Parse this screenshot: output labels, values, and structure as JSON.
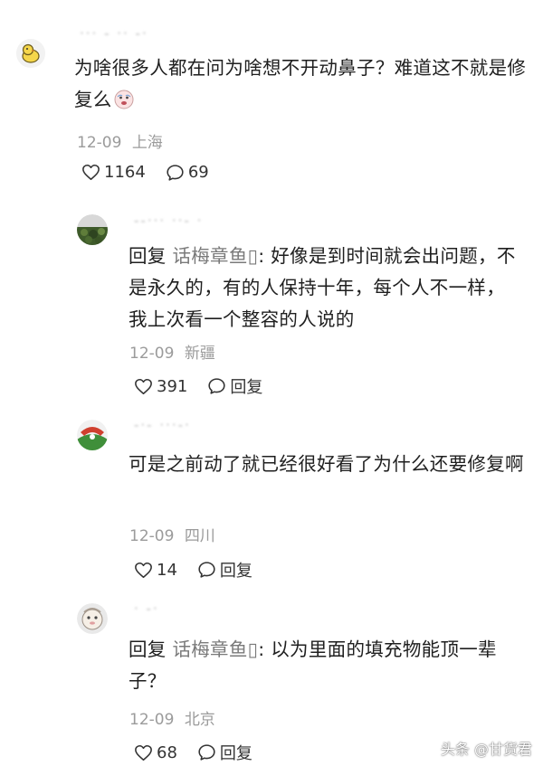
{
  "comments": [
    {
      "username": "··· ‐ ·· ‐·",
      "text": "为啥很多人都在问为啥想不开动鼻子？难道这不就是修复么",
      "emoji": "emoji-face-icon",
      "date": "12-09",
      "location": "上海",
      "likes": "1164",
      "comments": "69"
    }
  ],
  "replies": [
    {
      "username": "‐‐···  ··‐ ·",
      "reply_prefix": "回复",
      "reply_target": "话梅章鱼▯",
      "text": ": 好像是到时间就会出问题，不是永久的，有的人保持十年，每个人不一样，我上次看一个整容的人说的",
      "date": "12-09",
      "location": "新疆",
      "likes": "391",
      "reply_label": "回复"
    },
    {
      "username": "‐·‐  ···‐·",
      "reply_prefix": "",
      "reply_target": "",
      "text": "可是之前动了就已经很好看了为什么还要修复啊",
      "date": "12-09",
      "location": "四川",
      "likes": "14",
      "reply_label": "回复"
    },
    {
      "username": "· ‐·",
      "reply_prefix": "回复",
      "reply_target": "话梅章鱼▯",
      "text": ": 以为里面的填充物能顶一辈子？",
      "date": "12-09",
      "location": "北京",
      "likes": "68",
      "reply_label": "回复"
    }
  ],
  "watermark": "头条 @甘货君"
}
